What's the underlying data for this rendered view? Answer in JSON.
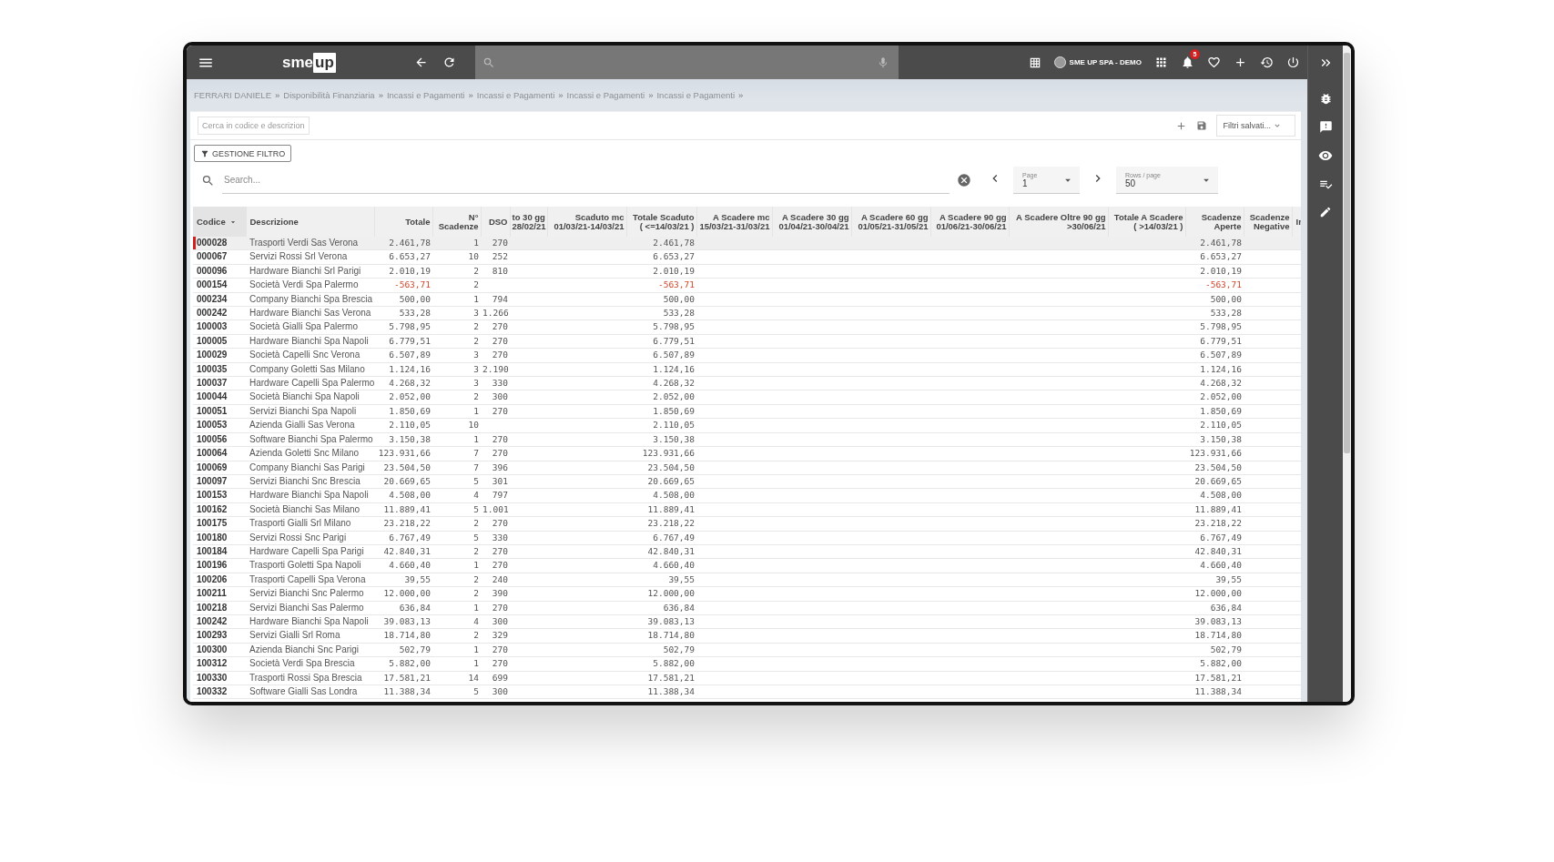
{
  "top_bar": {
    "logo": {
      "left": "sme",
      "right": "up"
    },
    "company": "SME UP SPA - DEMO",
    "notifications": "5"
  },
  "breadcrumb": {
    "separator": "»",
    "items": [
      "FERRARI DANIELE",
      "Disponibilità Finanziaria",
      "Incassi e Pagamenti",
      "Incassi e Pagamenti",
      "Incassi e Pagamenti",
      "Incassi e Pagamenti"
    ]
  },
  "filter_bar": {
    "code_search": {
      "placeholder": "Cerca in codice e descrizion"
    },
    "saved_filters": "Filtri salvati...",
    "filter_button": "GESTIONE FILTRO"
  },
  "search": {
    "placeholder": "Search..."
  },
  "pagination": {
    "page_label": "Page",
    "page": "1",
    "rows_label": "Rows / page",
    "rows_per_page": "50"
  },
  "table": {
    "columns": [
      {
        "lines": [
          "Codice"
        ],
        "kind": "text",
        "sorted": true
      },
      {
        "lines": [
          "Descrizione"
        ],
        "kind": "text",
        "sorted": false
      },
      {
        "lines": [
          "Totale"
        ],
        "kind": "number",
        "sorted": false
      },
      {
        "lines": [
          "N°",
          "Scadenze"
        ],
        "kind": "number",
        "sorted": false
      },
      {
        "lines": [
          "DSO"
        ],
        "kind": "number",
        "sorted": false
      },
      {
        "lines": [
          "to 30 gg",
          "28/02/21"
        ],
        "kind": "number",
        "sorted": false
      },
      {
        "lines": [
          "Scaduto mc",
          "01/03/21-14/03/21"
        ],
        "kind": "number",
        "sorted": false
      },
      {
        "lines": [
          "Totale Scaduto",
          "( <=14/03/21 )"
        ],
        "kind": "number",
        "sorted": false
      },
      {
        "lines": [
          "A Scadere mc",
          "15/03/21-31/03/21"
        ],
        "kind": "number",
        "sorted": false
      },
      {
        "lines": [
          "A Scadere 30 gg",
          "01/04/21-30/04/21"
        ],
        "kind": "number",
        "sorted": false
      },
      {
        "lines": [
          "A Scadere 60 gg",
          "01/05/21-31/05/21"
        ],
        "kind": "number",
        "sorted": false
      },
      {
        "lines": [
          "A Scadere 90 gg",
          "01/06/21-30/06/21"
        ],
        "kind": "number",
        "sorted": false
      },
      {
        "lines": [
          "A Scadere Oltre 90 gg",
          ">30/06/21"
        ],
        "kind": "number",
        "sorted": false
      },
      {
        "lines": [
          "Totale A Scadere",
          "( >14/03/21 )"
        ],
        "kind": "number",
        "sorted": false
      },
      {
        "lines": [
          "Scadenze",
          "Aperte"
        ],
        "kind": "number",
        "sorted": false
      },
      {
        "lines": [
          "Scadenze",
          "Negative"
        ],
        "kind": "number",
        "sorted": false
      },
      {
        "lines": [
          "Ir"
        ],
        "kind": "text",
        "sorted": false
      }
    ],
    "rows": [
      {
        "selected": true,
        "negative": false,
        "code": "000028",
        "description": "Trasporti Verdi Sas Verona",
        "total": "2.461,78",
        "count": "1",
        "dso": "270",
        "overdue_total": "2.461,78",
        "open_total": "2.461,78"
      },
      {
        "selected": false,
        "negative": false,
        "code": "000067",
        "description": "Servizi Rossi Srl Verona",
        "total": "6.653,27",
        "count": "10",
        "dso": "252",
        "overdue_total": "6.653,27",
        "open_total": "6.653,27"
      },
      {
        "selected": false,
        "negative": false,
        "code": "000096",
        "description": "Hardware Bianchi Srl Parigi",
        "total": "2.010,19",
        "count": "2",
        "dso": "810",
        "overdue_total": "2.010,19",
        "open_total": "2.010,19"
      },
      {
        "selected": false,
        "negative": true,
        "code": "000154",
        "description": "Società Verdi Spa Palermo",
        "total": "-563,71",
        "count": "2",
        "overdue_total": "-563,71",
        "open_total": "-563,71"
      },
      {
        "selected": false,
        "negative": false,
        "code": "000234",
        "description": "Company Bianchi Spa Brescia",
        "total": "500,00",
        "count": "1",
        "dso": "794",
        "overdue_total": "500,00",
        "open_total": "500,00"
      },
      {
        "selected": false,
        "negative": false,
        "code": "000242",
        "description": "Hardware Bianchi Sas Verona",
        "total": "533,28",
        "count": "3",
        "dso": "1.266",
        "overdue_total": "533,28",
        "open_total": "533,28"
      },
      {
        "selected": false,
        "negative": false,
        "code": "100003",
        "description": "Società Gialli Spa Palermo",
        "total": "5.798,95",
        "count": "2",
        "dso": "270",
        "overdue_total": "5.798,95",
        "open_total": "5.798,95"
      },
      {
        "selected": false,
        "negative": false,
        "code": "100005",
        "description": "Hardware Bianchi Spa Napoli",
        "total": "6.779,51",
        "count": "2",
        "dso": "270",
        "overdue_total": "6.779,51",
        "open_total": "6.779,51"
      },
      {
        "selected": false,
        "negative": false,
        "code": "100029",
        "description": "Società Capelli Snc Verona",
        "total": "6.507,89",
        "count": "3",
        "dso": "270",
        "overdue_total": "6.507,89",
        "open_total": "6.507,89"
      },
      {
        "selected": false,
        "negative": false,
        "code": "100035",
        "description": "Company Goletti Sas Milano",
        "total": "1.124,16",
        "count": "3",
        "dso": "2.190",
        "overdue_total": "1.124,16",
        "open_total": "1.124,16"
      },
      {
        "selected": false,
        "negative": false,
        "code": "100037",
        "description": "Hardware Capelli Spa Palermo",
        "total": "4.268,32",
        "count": "3",
        "dso": "330",
        "overdue_total": "4.268,32",
        "open_total": "4.268,32"
      },
      {
        "selected": false,
        "negative": false,
        "code": "100044",
        "description": "Società Bianchi Spa Napoli",
        "total": "2.052,00",
        "count": "2",
        "dso": "300",
        "overdue_total": "2.052,00",
        "open_total": "2.052,00"
      },
      {
        "selected": false,
        "negative": false,
        "code": "100051",
        "description": "Servizi Bianchi Spa Napoli",
        "total": "1.850,69",
        "count": "1",
        "dso": "270",
        "overdue_total": "1.850,69",
        "open_total": "1.850,69"
      },
      {
        "selected": false,
        "negative": false,
        "code": "100053",
        "description": "Azienda Gialli Sas Verona",
        "total": "2.110,05",
        "count": "10",
        "overdue_total": "2.110,05",
        "open_total": "2.110,05"
      },
      {
        "selected": false,
        "negative": false,
        "code": "100056",
        "description": "Software Bianchi Spa Palermo",
        "total": "3.150,38",
        "count": "1",
        "dso": "270",
        "overdue_total": "3.150,38",
        "open_total": "3.150,38"
      },
      {
        "selected": false,
        "negative": false,
        "code": "100064",
        "description": "Azienda Goletti Snc Milano",
        "total": "123.931,66",
        "count": "7",
        "dso": "270",
        "overdue_total": "123.931,66",
        "open_total": "123.931,66"
      },
      {
        "selected": false,
        "negative": false,
        "code": "100069",
        "description": "Company Bianchi Sas Parigi",
        "total": "23.504,50",
        "count": "7",
        "dso": "396",
        "overdue_total": "23.504,50",
        "open_total": "23.504,50"
      },
      {
        "selected": false,
        "negative": false,
        "code": "100097",
        "description": "Servizi Bianchi Snc Brescia",
        "total": "20.669,65",
        "count": "5",
        "dso": "301",
        "overdue_total": "20.669,65",
        "open_total": "20.669,65"
      },
      {
        "selected": false,
        "negative": false,
        "code": "100153",
        "description": "Hardware Bianchi Spa Napoli",
        "total": "4.508,00",
        "count": "4",
        "dso": "797",
        "overdue_total": "4.508,00",
        "open_total": "4.508,00"
      },
      {
        "selected": false,
        "negative": false,
        "code": "100162",
        "description": "Società Bianchi Sas Milano",
        "total": "11.889,41",
        "count": "5",
        "dso": "1.001",
        "overdue_total": "11.889,41",
        "open_total": "11.889,41"
      },
      {
        "selected": false,
        "negative": false,
        "code": "100175",
        "description": "Trasporti Gialli Srl Milano",
        "total": "23.218,22",
        "count": "2",
        "dso": "270",
        "overdue_total": "23.218,22",
        "open_total": "23.218,22"
      },
      {
        "selected": false,
        "negative": false,
        "code": "100180",
        "description": "Servizi Rossi Snc Parigi",
        "total": "6.767,49",
        "count": "5",
        "dso": "330",
        "overdue_total": "6.767,49",
        "open_total": "6.767,49"
      },
      {
        "selected": false,
        "negative": false,
        "code": "100184",
        "description": "Hardware Capelli Spa Parigi",
        "total": "42.840,31",
        "count": "2",
        "dso": "270",
        "overdue_total": "42.840,31",
        "open_total": "42.840,31"
      },
      {
        "selected": false,
        "negative": false,
        "code": "100196",
        "description": "Trasporti Goletti Spa Napoli",
        "total": "4.660,40",
        "count": "1",
        "dso": "270",
        "overdue_total": "4.660,40",
        "open_total": "4.660,40"
      },
      {
        "selected": false,
        "negative": false,
        "code": "100206",
        "description": "Trasporti Capelli Spa Verona",
        "total": "39,55",
        "count": "2",
        "dso": "240",
        "overdue_total": "39,55",
        "open_total": "39,55"
      },
      {
        "selected": false,
        "negative": false,
        "code": "100211",
        "description": "Servizi Bianchi Snc Palermo",
        "total": "12.000,00",
        "count": "2",
        "dso": "390",
        "overdue_total": "12.000,00",
        "open_total": "12.000,00"
      },
      {
        "selected": false,
        "negative": false,
        "code": "100218",
        "description": "Servizi Bianchi Sas Palermo",
        "total": "636,84",
        "count": "1",
        "dso": "270",
        "overdue_total": "636,84",
        "open_total": "636,84"
      },
      {
        "selected": false,
        "negative": false,
        "code": "100242",
        "description": "Hardware Bianchi Spa Napoli",
        "total": "39.083,13",
        "count": "4",
        "dso": "300",
        "overdue_total": "39.083,13",
        "open_total": "39.083,13"
      },
      {
        "selected": false,
        "negative": false,
        "code": "100293",
        "description": "Servizi Gialli Srl Roma",
        "total": "18.714,80",
        "count": "2",
        "dso": "329",
        "overdue_total": "18.714,80",
        "open_total": "18.714,80"
      },
      {
        "selected": false,
        "negative": false,
        "code": "100300",
        "description": "Azienda Bianchi Snc Parigi",
        "total": "502,79",
        "count": "1",
        "dso": "270",
        "overdue_total": "502,79",
        "open_total": "502,79"
      },
      {
        "selected": false,
        "negative": false,
        "code": "100312",
        "description": "Società Verdi Spa Brescia",
        "total": "5.882,00",
        "count": "1",
        "dso": "270",
        "overdue_total": "5.882,00",
        "open_total": "5.882,00"
      },
      {
        "selected": false,
        "negative": false,
        "code": "100330",
        "description": "Trasporti Rossi Spa Brescia",
        "total": "17.581,21",
        "count": "14",
        "dso": "699",
        "overdue_total": "17.581,21",
        "open_total": "17.581,21"
      },
      {
        "selected": false,
        "negative": false,
        "code": "100332",
        "description": "Software Gialli Sas Londra",
        "total": "11.388,34",
        "count": "5",
        "dso": "300",
        "overdue_total": "11.388,34",
        "open_total": "11.388,34"
      }
    ]
  }
}
